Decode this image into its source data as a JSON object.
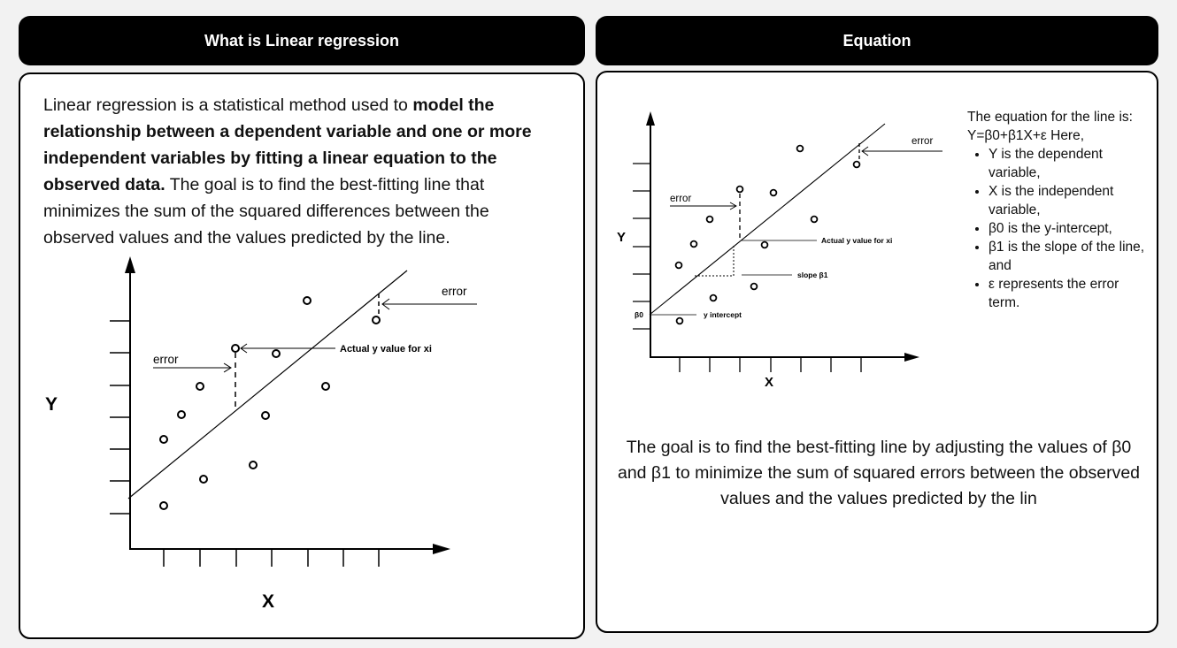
{
  "left": {
    "header": "What is Linear regression",
    "intro": {
      "part1": "Linear regression is a statistical method used to ",
      "bold": "model the relationship between a dependent variable and one or more independent variables by fitting a linear equation to the observed data.",
      "part2": " The goal is to find the best-fitting line that minimizes the sum of the squared differences between the observed values and the values predicted by the line."
    },
    "diagram": {
      "y_label": "Y",
      "x_label": "X",
      "error_label_top": "error",
      "error_label_left": "error",
      "actual_label": "Actual y value for xi"
    }
  },
  "right": {
    "header": "Equation",
    "diagram": {
      "y_label": "Y",
      "x_label": "X",
      "error_label_top": "error",
      "error_label_left": "error",
      "actual_label": "Actual y value for xi",
      "slope_label": "slope β1",
      "intercept_label": "y intercept",
      "beta0_label": "β0"
    },
    "equation_intro": "The equation for the line is: Y=β0+β1X+ε Here,",
    "bullets": [
      "Y is the dependent variable,",
      "X is the independent variable,",
      "β0 is the y-intercept,",
      "β1 is the slope of the line, and",
      "ε represents the error term."
    ],
    "goal_text": "The goal is to find the best-fitting line by adjusting the values of β0 and β1 to minimize the sum of squared errors between the observed values and the values predicted by the lin"
  }
}
